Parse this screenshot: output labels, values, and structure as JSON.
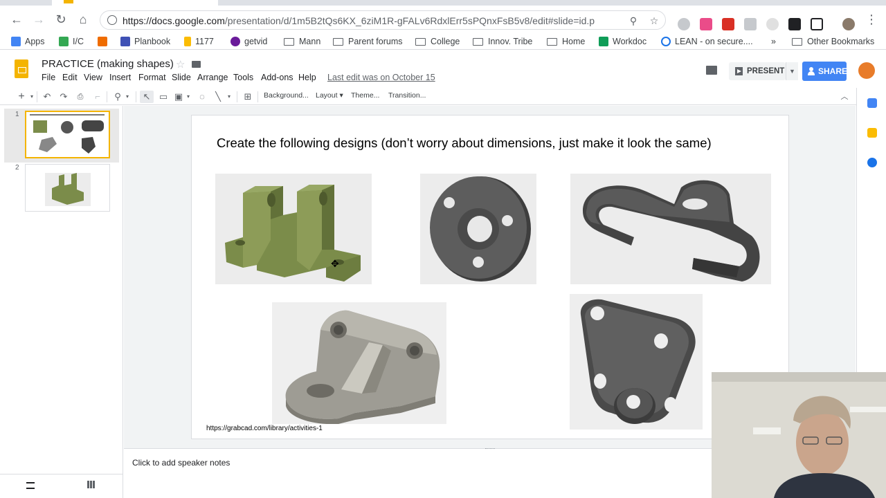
{
  "browser": {
    "url_main": "https://docs.google.com",
    "url_rest": "/presentation/d/1m5B2tQs6KX_6ziM1R-gFALv6RdxlErr5sPQnxFsB5v8/edit#slide=id.p"
  },
  "bookmarks": {
    "items": [
      "Apps",
      "I/C",
      "Planbook",
      "1177",
      "getvid",
      "Mann",
      "Parent forums",
      "College",
      "Innov. Tribe",
      "Home",
      "Workdoc",
      "LEAN - on secure....",
      "»",
      "Other Bookmarks"
    ]
  },
  "doc": {
    "title": "PRACTICE (making shapes)",
    "menus": [
      "File",
      "Edit",
      "View",
      "Insert",
      "Format",
      "Slide",
      "Arrange",
      "Tools",
      "Add-ons",
      "Help"
    ],
    "last_edit": "Last edit was on October 15",
    "present_label": "PRESENT",
    "share_label": "SHARE"
  },
  "toolbar": {
    "background": "Background...",
    "layout": "Layout ▾",
    "theme": "Theme...",
    "transition": "Transition..."
  },
  "filmstrip": {
    "slides": [
      {
        "number": "1"
      },
      {
        "number": "2"
      }
    ]
  },
  "slide": {
    "title": "Create the following designs (don’t worry about dimensions, just make it look the same)",
    "credit": "https://grabcad.com/library/activities-1"
  },
  "notes": {
    "placeholder": "Click to add speaker notes"
  },
  "colors": {
    "accent": "#f4b400",
    "share": "#4285f4",
    "part_green": "#7b8c4a",
    "part_gray": "#5a5a5a"
  }
}
